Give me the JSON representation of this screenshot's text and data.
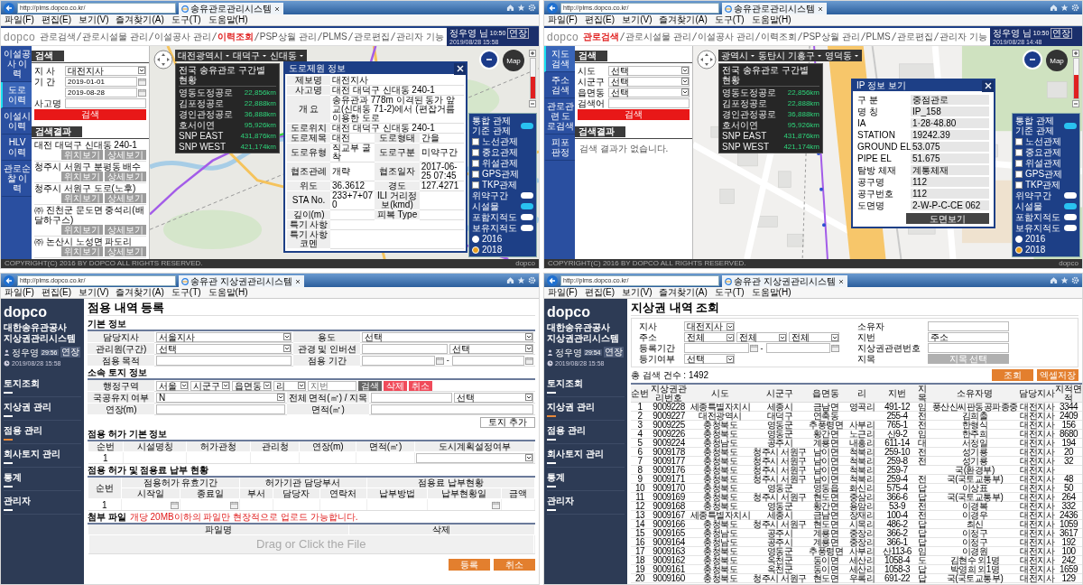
{
  "map_popup_screen": {
    "browser": {
      "url": "http://plms.dopco.co.kr/",
      "tab_title": "송유관로관리시스템",
      "menu": [
        "파일(F)",
        "편집(E)",
        "보기(V)",
        "즐겨찾기(A)",
        "도구(T)",
        "도움말(H)"
      ]
    },
    "logo": "dopco",
    "nav": [
      {
        "label": "관로검색",
        "selected": false
      },
      {
        "label": "관로시설물 관리",
        "selected": false
      },
      {
        "label": "이설공사 관리",
        "selected": false
      },
      {
        "label": "이력조회",
        "selected": true
      },
      {
        "label": "PSP상월 관리",
        "selected": false
      },
      {
        "label": "PLMS",
        "selected": false
      },
      {
        "label": "관로편집",
        "selected": false
      },
      {
        "label": "관리자 기능",
        "selected": false
      }
    ],
    "user": {
      "name": "정우영 님",
      "session": "10:50",
      "extend": "연장",
      "datetime": "2019/08/28 15:58"
    },
    "side_tabs": [
      {
        "label": "이설공사 이력",
        "selected": false
      },
      {
        "label": "도로 이력",
        "selected": true
      },
      {
        "label": "이설시 이력",
        "selected": false
      },
      {
        "label": "HLV 이력",
        "selected": false
      },
      {
        "label": "관로순찰 이력",
        "selected": false
      }
    ],
    "search": {
      "title": "검색",
      "fields": [
        {
          "label": "지 사",
          "kind": "select",
          "value": "대전지사"
        },
        {
          "label": "기 간",
          "kind": "date",
          "value": "2019-01-01"
        },
        {
          "kind": "date",
          "value": "2019-08-28"
        },
        {
          "label": "사고명",
          "kind": "text"
        }
      ],
      "button": "검색"
    },
    "results": {
      "title": "검색결과",
      "items": [
        {
          "title": "대전 대덕구 신대동 240-1",
          "buttons": [
            "위치보기",
            "상세보기"
          ]
        },
        {
          "title": "청주시 서원구 분평동 배수",
          "buttons": [
            "위치보기",
            "상세보기"
          ]
        },
        {
          "title": "청주시 서원구 도로(노후)",
          "buttons": [
            "위치보기",
            "상세보기"
          ]
        },
        {
          "title": "㈜ 진천군 문도면 중석리(배달하구스)",
          "buttons": [
            "위치보기",
            "상세보기"
          ]
        },
        {
          "title": "㈜ 논산시 노성면 파도리",
          "buttons": [
            "위치보기",
            "상세보기"
          ]
        }
      ]
    },
    "map": {
      "kind": "regional"
    },
    "region_selects": [
      "대전광역시",
      "대덕구",
      "신대동"
    ],
    "stats": {
      "title": "전국 송유관로 구간별 현황",
      "rows": [
        {
          "name": "영동도정공로",
          "value": "22,856km"
        },
        {
          "name": "김포정공로",
          "value": "22,888km"
        },
        {
          "name": "경인관정공로",
          "value": "36,888km"
        },
        {
          "name": "호서이연",
          "value": "95,926km"
        },
        {
          "name": "SNP EAST",
          "value": "431,876km"
        },
        {
          "name": "SNP WEST",
          "value": "421,174km"
        }
      ]
    },
    "popup": {
      "kind": "road",
      "title": "도로제원 정보",
      "rows": [
        {
          "cells": [
            {
              "label": "제보명",
              "value": "대전지사"
            }
          ]
        },
        {
          "cells": [
            {
              "label": "사고명",
              "value": "대전 대덕구 신대동 240-1"
            }
          ]
        },
        {
          "cells": [
            {
              "label": "개 요",
              "value": "송유관과 778m 이격된 동가 앞교(신대동 71-2)에서 (편잡거름 이용한 도로"
            }
          ]
        },
        {
          "cells": [
            {
              "label": "도로위치",
              "value": "대전 대덕구 신대동 240-1"
            }
          ]
        },
        {
          "cells": [
            {
              "label": "도로제목",
              "value": "대전"
            },
            {
              "label": "도로형태",
              "value": "간을"
            }
          ]
        },
        {
          "cells": [
            {
              "label": "도로유형",
              "value": "직교부 굴착"
            },
            {
              "label": "도로구분",
              "value": "미약구간"
            }
          ]
        },
        {
          "cells": [
            {
              "label": "협조관례",
              "value": "개략"
            },
            {
              "label": "협조일자",
              "value": "2017-06-25 07:45"
            }
          ]
        },
        {
          "cells": [
            {
              "label": "위도",
              "value": "36.3612"
            },
            {
              "label": "경도",
              "value": "127.4271"
            }
          ]
        },
        {
          "cells": [
            {
              "label": "STA No.",
              "value": "233+7+070"
            },
            {
              "label": "ILI 거리정보(kmd)"
            }
          ]
        },
        {
          "cells": [
            {
              "label": "깊이(m)"
            },
            {
              "label": "피복 Type"
            }
          ]
        },
        {
          "cells": [
            {
              "label": "특기 사항"
            }
          ]
        },
        {
          "cells": [
            {
              "label": "특기 사항 코멘"
            }
          ]
        }
      ]
    },
    "map_button": "Map",
    "zoom": {
      "level": 0.55
    },
    "legend": [
      {
        "kind": "toggle",
        "label": "통합 관제 기준 관제",
        "on": true
      },
      {
        "kind": "check",
        "label": "노선관제",
        "checked": false
      },
      {
        "kind": "check",
        "label": "중요관제",
        "checked": false
      },
      {
        "kind": "check",
        "label": "위설관제",
        "checked": false
      },
      {
        "kind": "check",
        "label": "GPS관제",
        "checked": false
      },
      {
        "kind": "check",
        "label": "TKP관제",
        "checked": false
      },
      {
        "kind": "toggle",
        "label": "위약구간",
        "on": false
      },
      {
        "kind": "toggle",
        "label": "시설물",
        "on": true
      },
      {
        "kind": "toggle",
        "label": "포함지적도",
        "on": false
      },
      {
        "kind": "toggle",
        "label": "보유지적도",
        "on": false
      },
      {
        "kind": "radio",
        "label": "2016",
        "selected": false
      },
      {
        "kind": "radio",
        "label": "2018",
        "selected": true
      }
    ],
    "footer": {
      "copyright": "COPYRIGHT(C) 2016 BY DOPCO ALL RIGHTS RESERVED.",
      "logo": "dopco"
    }
  },
  "map_ip_screen": {
    "browser": {
      "url": "http://plms.dopco.co.kr/",
      "tab_title": "송유관로관리시스템",
      "menu": [
        "파일(F)",
        "편집(E)",
        "보기(V)",
        "즐겨찾기(A)",
        "도구(T)",
        "도움말(H)"
      ]
    },
    "logo": "dopco",
    "nav": [
      {
        "label": "관로검색",
        "selected": true
      },
      {
        "label": "관로시설물 관리",
        "selected": false
      },
      {
        "label": "이설공사 관리",
        "selected": false
      },
      {
        "label": "이력조회",
        "selected": false
      },
      {
        "label": "PSP상월 관리",
        "selected": false
      },
      {
        "label": "PLMS",
        "selected": false
      },
      {
        "label": "관로편집",
        "selected": false
      },
      {
        "label": "관리자 기능",
        "selected": false
      }
    ],
    "user": {
      "name": "정우영 님",
      "session": "10:50",
      "extend": "연장",
      "datetime": "2019/08/28 14:48"
    },
    "side_tabs": [
      {
        "label": "지도 검색",
        "selected": true
      },
      {
        "label": "주소 검색",
        "selected": false
      },
      {
        "label": "관로관련 도로검색",
        "selected": false
      },
      {
        "label": "피포 판정",
        "selected": false
      }
    ],
    "search": {
      "title": "검색",
      "fields": [
        {
          "label": "시도",
          "kind": "select",
          "value": "선택"
        },
        {
          "label": "시군구",
          "kind": "select",
          "value": "선택"
        },
        {
          "label": "읍면동",
          "kind": "select",
          "value": "선택"
        },
        {
          "label": "검색어",
          "kind": "text"
        }
      ],
      "button": "검색"
    },
    "results": {
      "title": "검색결과",
      "empty": "검색 결과가 없습니다."
    },
    "map": {
      "kind": "street"
    },
    "region_selects": [
      "광역시",
      "동탄시 기흥구",
      "영덕동"
    ],
    "stats": {
      "title": "전국 송유관로 구간별 현황",
      "rows": [
        {
          "name": "영동도정공로",
          "value": "22,856km"
        },
        {
          "name": "김포정공로",
          "value": "22,888km"
        },
        {
          "name": "경인관정공로",
          "value": "36,888km"
        },
        {
          "name": "호서이연",
          "value": "95,926km"
        },
        {
          "name": "SNP EAST",
          "value": "431,876km"
        },
        {
          "name": "SNP WEST",
          "value": "421,174km"
        }
      ]
    },
    "popup": {
      "kind": "ip",
      "title": "IP 정보 보기",
      "rows": [
        {
          "label": "구 분",
          "value": "중점관로"
        },
        {
          "label": "명 칭",
          "value": "IP_158"
        },
        {
          "label": "IA",
          "value": "1·28·48.80"
        },
        {
          "label": "STATION",
          "value": "19242.39"
        },
        {
          "label": "GROUND EL",
          "value": "53.075"
        },
        {
          "label": "PIPE EL",
          "value": "51.675"
        },
        {
          "label": "탐방 체재",
          "value": "계통체재"
        },
        {
          "label": "공구명",
          "value": "112"
        },
        {
          "label": "공구번호",
          "value": "112"
        },
        {
          "label": "도면명",
          "value": "2-W-P-C-CE 062"
        }
      ],
      "button": "도면보기"
    },
    "map_button": "Map",
    "zoom": {
      "level": 0.6
    },
    "legend": [
      {
        "kind": "toggle",
        "label": "통합 관제 기준 관제",
        "on": true
      },
      {
        "kind": "check",
        "label": "노선관제",
        "checked": false
      },
      {
        "kind": "check",
        "label": "중요관제",
        "checked": false
      },
      {
        "kind": "check",
        "label": "위설관제",
        "checked": false
      },
      {
        "kind": "check",
        "label": "GPS관제",
        "checked": false
      },
      {
        "kind": "check",
        "label": "TKP관제",
        "checked": false
      },
      {
        "kind": "toggle",
        "label": "위약구간",
        "on": false
      },
      {
        "kind": "toggle",
        "label": "시설물",
        "on": true
      },
      {
        "kind": "toggle",
        "label": "포함지적도",
        "on": false
      },
      {
        "kind": "toggle",
        "label": "보유지적도",
        "on": false
      },
      {
        "kind": "radio",
        "label": "2016",
        "selected": false
      },
      {
        "kind": "radio",
        "label": "2018",
        "selected": true
      }
    ],
    "footer": {
      "copyright": "COPYRIGHT(C) 2016 BY DOPCO ALL RIGHTS RESERVED.",
      "logo": "dopco"
    }
  },
  "register_screen": {
    "browser": {
      "url": "http://plms.dopco.co.kr/",
      "tab_title": "송유관 지상권관리시스템",
      "menu": [
        "파일(F)",
        "편집(E)",
        "보기(V)",
        "즐겨찾기(A)",
        "도구(T)",
        "도움말(H)"
      ]
    },
    "sidebar": {
      "logo": "dopco",
      "org": "대한송유관공사",
      "system": "지상권관리시스템",
      "user": "정우영",
      "timer": "29:56",
      "extend": "연장",
      "datetime": "2019/08/28 15:58",
      "menu": [
        {
          "label": "토지조회",
          "selected": false
        },
        {
          "label": "지상권 관리",
          "selected": false
        },
        {
          "label": "점용 관리",
          "selected": true
        },
        {
          "label": "회사토지 관리",
          "selected": false
        },
        {
          "label": "통계",
          "selected": false
        },
        {
          "label": "관리자",
          "selected": false
        }
      ]
    },
    "title": "점용 내역 등록",
    "basic": {
      "title": "기본 정보",
      "rows": [
        {
          "cells": [
            {
              "label": "담당지사",
              "inputs": [
                {
                  "kind": "select",
                  "value": "서울지사"
                }
              ]
            },
            {
              "label": "용도",
              "inputs": [
                {
                  "kind": "select",
                  "value": "선택"
                }
              ]
            }
          ]
        },
        {
          "cells": [
            {
              "label": "관리원(구간)",
              "inputs": [
                {
                  "kind": "select",
                  "value": "선택"
                }
              ]
            },
            {
              "label": "관경 및 인버션",
              "inputs": [
                {
                  "kind": "text"
                },
                {
                  "kind": "select",
                  "value": "선택"
                }
              ]
            }
          ]
        },
        {
          "cells": [
            {
              "label": "점용 목적",
              "inputs": [
                {
                  "kind": "text"
                }
              ]
            },
            {
              "label": "점용 기간",
              "inputs": [
                {
                  "kind": "date"
                },
                {
                  "kind": "sep",
                  "value": "-"
                },
                {
                  "kind": "date"
                }
              ]
            }
          ]
        }
      ]
    },
    "land": {
      "title": "소속 토지 정보",
      "rows": [
        {
          "cells": [
            {
              "label": "행정구역",
              "inputs": [
                {
                  "kind": "select",
                  "value": "서울"
                },
                {
                  "kind": "select",
                  "value": "시군구"
                },
                {
                  "kind": "select",
                  "value": "읍면동"
                },
                {
                  "kind": "select",
                  "value": "리"
                },
                {
                  "kind": "text",
                  "placeholder": "지번"
                },
                {
                  "kind": "darkbutton",
                  "value": "검색"
                },
                {
                  "kind": "redbutton",
                  "value": "삭제"
                },
                {
                  "kind": "redbutton",
                  "value": "취소"
                }
              ]
            }
          ]
        },
        {
          "cells": [
            {
              "label": "국공유지 여부",
              "inputs": [
                {
                  "kind": "select",
                  "value": "N"
                }
              ]
            },
            {
              "label": "전체 면적(㎡) / 지목",
              "inputs": [
                {
                  "kind": "text"
                },
                {
                  "kind": "select",
                  "value": "선택"
                }
              ]
            }
          ]
        },
        {
          "cells": [
            {
              "label": "연장(m)",
              "inputs": [
                {
                  "kind": "text"
                }
              ]
            },
            {
              "label": "면적(㎡)",
              "inputs": [
                {
                  "kind": "text"
                }
              ]
            }
          ]
        }
      ],
      "add_button": "토지 추가"
    },
    "permit": {
      "title": "점용 허가 기본 정보",
      "columns": [
        "순번",
        "시설명칭",
        "허가관청",
        "관리청",
        "연장(m)",
        "면적(㎡)",
        "도시계획설정여부"
      ],
      "rows": [
        {
          "no": "1"
        }
      ]
    },
    "payment": {
      "title": "점용 허가 및 점용료 납부 현황",
      "no_column": "순번",
      "groups": [
        {
          "label": "점용허가 유효기간",
          "columns": [
            {
              "label": "시작일",
              "kind": "date"
            },
            {
              "label": "종료일",
              "kind": "date"
            }
          ]
        },
        {
          "label": "허가기관 담당부서",
          "columns": [
            {
              "label": "부서",
              "kind": "text"
            },
            {
              "label": "담당자",
              "kind": "text"
            },
            {
              "label": "연락처",
              "kind": "text"
            }
          ]
        },
        {
          "label": "점용료 납부현황",
          "columns": [
            {
              "label": "납부방법",
              "kind": "text"
            },
            {
              "label": "납부현황일",
              "kind": "date"
            },
            {
              "label": "금액",
              "kind": "text"
            }
          ]
        }
      ],
      "rows": [
        {
          "no": "1"
        }
      ]
    },
    "attach": {
      "title": "첨부 파일",
      "note": "개당 20MB이하의 파일만 현장적으로 업로드 가능합니다.",
      "columns": [
        "파일명",
        "삭제"
      ],
      "dropzone": "Drag or Click the File"
    },
    "buttons": [
      "등록",
      "취소"
    ]
  },
  "lookup_screen": {
    "browser": {
      "url": "http://plms.dopco.co.kr/",
      "tab_title": "송유관 지상권관리시스템",
      "menu": [
        "파일(F)",
        "편집(E)",
        "보기(V)",
        "즐겨찾기(A)",
        "도구(T)",
        "도움말(H)"
      ]
    },
    "sidebar": {
      "logo": "dopco",
      "org": "대한송유관공사",
      "system": "지상권관리시스템",
      "user": "정우영",
      "timer": "29:54",
      "extend": "연장",
      "datetime": "2019/08/28 15:58",
      "menu": [
        {
          "label": "토지조회",
          "selected": false
        },
        {
          "label": "지상권 관리",
          "selected": true
        },
        {
          "label": "점용 관리",
          "selected": false
        },
        {
          "label": "회사토지 관리",
          "selected": false
        },
        {
          "label": "통계",
          "selected": false
        },
        {
          "label": "관리자",
          "selected": false
        }
      ]
    },
    "title": "지상권 내역 조회",
    "filters_left": [
      {
        "label": "지사",
        "inputs": [
          {
            "kind": "select",
            "value": "대전지사"
          }
        ]
      },
      {
        "label": "주소",
        "inputs": [
          {
            "kind": "select",
            "value": "전체"
          },
          {
            "kind": "select",
            "value": "전체"
          },
          {
            "kind": "select",
            "value": "전체"
          }
        ]
      },
      {
        "label": "등록기간",
        "inputs": [
          {
            "kind": "date"
          },
          {
            "kind": "sep",
            "value": "-"
          },
          {
            "kind": "date"
          }
        ]
      },
      {
        "label": "등기여부",
        "inputs": [
          {
            "kind": "select",
            "value": "선택"
          }
        ]
      }
    ],
    "filters_right": [
      {
        "label": "소유자",
        "inputs": [
          {
            "kind": "text"
          }
        ]
      },
      {
        "label": "지번",
        "inputs": [
          {
            "kind": "text",
            "value": "주소"
          }
        ]
      },
      {
        "label": "지상권관련번호",
        "inputs": [
          {
            "kind": "text"
          }
        ]
      },
      {
        "label": "지목",
        "inputs": [
          {
            "kind": "greybutton",
            "value": "지목 선택"
          }
        ]
      }
    ],
    "buttons": [
      "조회",
      "엑셀저장"
    ],
    "count": "총 검색 건수 : 1492",
    "columns": [
      "순번",
      "지상권관리번호",
      "시도",
      "시군구",
      "읍면동",
      "리",
      "지번",
      "지목",
      "소유자명",
      "담당지사",
      "지적면적"
    ],
    "rows": [
      [
        "1",
        "9009228",
        "세종특별자치시",
        "세종시",
        "금남면",
        "영곡리",
        "491-12",
        "임",
        "풍산신씨판동공파종중",
        "대전지사",
        "3344"
      ],
      [
        "2",
        "9009227",
        "대전광역시",
        "대덕구",
        "연축동",
        "",
        "255-4",
        "전",
        "김희출",
        "대전지사",
        "2409"
      ],
      [
        "3",
        "9009225",
        "충청북도",
        "영동군",
        "추풍령면",
        "사부리",
        "765-1",
        "전",
        "한형식",
        "대전지사",
        "156"
      ],
      [
        "4",
        "9009226",
        "충청북도",
        "영동군",
        "황간면",
        "노근리",
        "산9-2",
        "임",
        "한주희",
        "대전지사",
        "8680"
      ],
      [
        "5",
        "9009224",
        "충청남도",
        "공주시",
        "계룡면",
        "내흥리",
        "611-14",
        "대",
        "서정일",
        "대전지사",
        "194"
      ],
      [
        "6",
        "9009178",
        "충청북도",
        "청주시 서원구",
        "남이면",
        "척북리",
        "259-10",
        "전",
        "성기룡",
        "대전지사",
        "20"
      ],
      [
        "7",
        "9009177",
        "충청북도",
        "청주시 서원구",
        "남이면",
        "척북리",
        "259-8",
        "전",
        "성기룡",
        "대전지사",
        "32"
      ],
      [
        "8",
        "9009176",
        "충청북도",
        "청주시 서원구",
        "남이면",
        "척북리",
        "259-7",
        "",
        "국(환경부)",
        "대전지사",
        ""
      ],
      [
        "9",
        "9009171",
        "충청북도",
        "청주시 서원구",
        "남이면",
        "척북리",
        "259-4",
        "전",
        "국(국토교통부)",
        "대전지사",
        "48"
      ],
      [
        "10",
        "9009170",
        "충청북도",
        "영동군",
        "영동읍",
        "화신리",
        "575-4",
        "답",
        "이상표",
        "대전지사",
        "50"
      ],
      [
        "11",
        "9009169",
        "충청북도",
        "청주시 서원구",
        "현도면",
        "중삼리",
        "366-6",
        "답",
        "국(국토교통부)",
        "대전지사",
        "264"
      ],
      [
        "12",
        "9009168",
        "충청북도",
        "영동군",
        "황간면",
        "용암리",
        "53-9",
        "전",
        "이경복",
        "대전지사",
        "332"
      ],
      [
        "13",
        "9009167",
        "세종특별자치시",
        "세종시",
        "금남면",
        "장재리",
        "100-4",
        "전",
        "이경우",
        "대전지사",
        "2436"
      ],
      [
        "14",
        "9009166",
        "충청북도",
        "청주시 서원구",
        "현도면",
        "시목리",
        "486-2",
        "답",
        "최신",
        "대전지사",
        "1059"
      ],
      [
        "15",
        "9009165",
        "충청남도",
        "공주시",
        "계룡면",
        "중장리",
        "366-2",
        "답",
        "이정구",
        "대전지사",
        "3617"
      ],
      [
        "16",
        "9009164",
        "충청남도",
        "공주시",
        "계룡면",
        "중장리",
        "366-1",
        "답",
        "이정구",
        "대전지사",
        "192"
      ],
      [
        "17",
        "9009163",
        "충청북도",
        "영동군",
        "추풍령면",
        "사부리",
        "산113-6",
        "임",
        "이경원",
        "대전지사",
        "100"
      ],
      [
        "18",
        "9009162",
        "충청북도",
        "옥천군",
        "동이면",
        "세산리",
        "1058-4",
        "도",
        "김현수 외1명",
        "대전지사",
        "242"
      ],
      [
        "19",
        "9009161",
        "충청북도",
        "옥천군",
        "동이면",
        "세산리",
        "1058-3",
        "답",
        "박영희 외1명",
        "대전지사",
        "1659"
      ],
      [
        "20",
        "9009160",
        "충청북도",
        "청주시 서원구",
        "현도면",
        "우록리",
        "691-22",
        "답",
        "국(국토교통부)",
        "대전지사",
        "129"
      ]
    ]
  }
}
